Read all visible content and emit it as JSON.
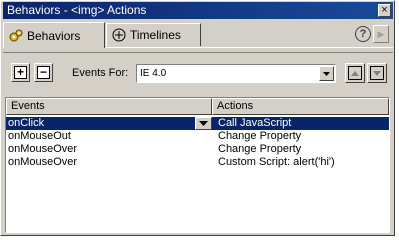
{
  "window": {
    "title": "Behaviors - <img> Actions",
    "close_label": "×"
  },
  "tabs": [
    {
      "label": "Behaviors",
      "icon": "gears-icon",
      "active": true
    },
    {
      "label": "Timelines",
      "icon": "timeline-icon",
      "active": false
    }
  ],
  "help_label": "?",
  "expand_label": "▶",
  "toolbar": {
    "add_label": "+",
    "remove_label": "−",
    "events_for_label": "Events For:",
    "events_for_value": "IE 4.0"
  },
  "table": {
    "headers": [
      "Events",
      "Actions"
    ],
    "rows": [
      {
        "event": "onClick",
        "action": "Call JavaScript",
        "selected": true
      },
      {
        "event": "onMouseOut",
        "action": "Change Property",
        "selected": false
      },
      {
        "event": "onMouseOver",
        "action": "Change Property",
        "selected": false
      },
      {
        "event": "onMouseOver",
        "action": "Custom Script: alert('hi')",
        "selected": false
      }
    ]
  },
  "colors": {
    "title_bar": "#0a246a",
    "selection": "#0a246a",
    "face": "#d4d0c8"
  }
}
